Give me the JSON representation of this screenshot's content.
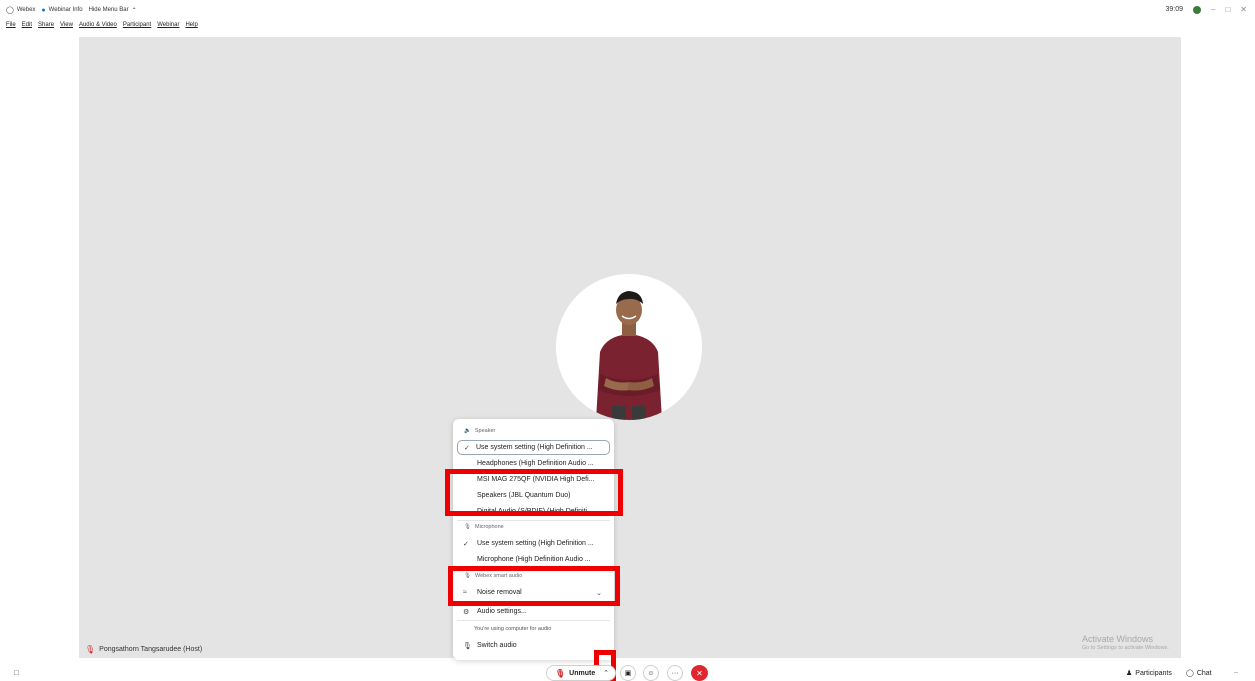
{
  "titlebar": {
    "app_name": "Webex",
    "webinar_info": "Webinar Info",
    "hide_menu_bar": "Hide Menu Bar",
    "timer": "39:09"
  },
  "menu": [
    "File",
    "Edit",
    "Share",
    "View",
    "Audio & Video",
    "Participant",
    "Webinar",
    "Help"
  ],
  "stage": {
    "host_label": "Pongsathorn Tangsarudee (Host)",
    "activate_title": "Activate Windows",
    "activate_sub": "Go to Settings to activate Windows."
  },
  "popup": {
    "speaker_label": "Speaker",
    "speaker_options": [
      "Use system setting (High Definition ...",
      "Headphones (High Definition Audio ...",
      "MSI MAG 275QF (NVIDIA High Defi...",
      "Speakers (JBL Quantum Duo)",
      "Digital Audio (S/PDIF) (High Definiti..."
    ],
    "microphone_label": "Microphone",
    "microphone_options": [
      "Use system setting (High Definition ...",
      "Microphone (High Definition Audio ..."
    ],
    "smart_audio_label": "Webex smart audio",
    "noise_removal": "Noise removal",
    "audio_settings": "Audio settings...",
    "using_computer_note": "You're using computer for audio",
    "switch_audio": "Switch audio"
  },
  "toolbar": {
    "unmute": "Unmute",
    "participants": "Participants",
    "chat": "Chat",
    "more": "···"
  },
  "colors": {
    "stage_bg": "#e4e4e4",
    "highlight": "#ee0000",
    "end_call": "#e2262e",
    "accent_green": "#3a7c3a"
  }
}
